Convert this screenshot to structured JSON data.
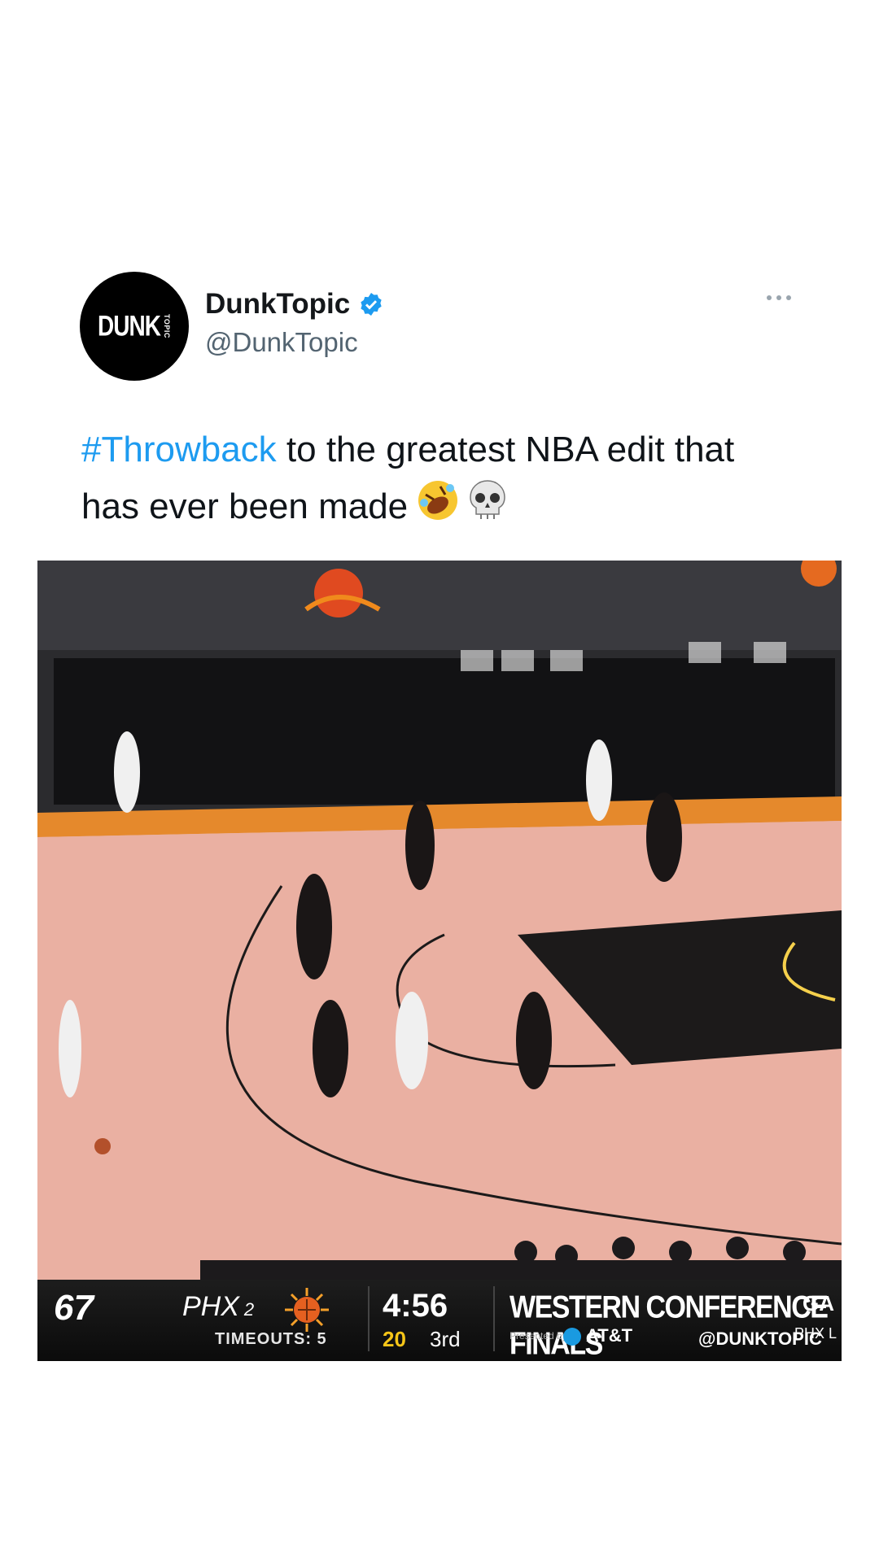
{
  "tweet": {
    "display_name": "DunkTopic",
    "handle": "@DunkTopic",
    "avatar_text": "DUNK",
    "avatar_subtext": "TOPIC",
    "hashtag": "#Throwback",
    "text": " to the greatest NBA edit that has ever been made",
    "emojis": [
      "rolling-on-floor-laughing-emoji",
      "skull-emoji"
    ],
    "accent_color": "#1d9bf0"
  },
  "video": {
    "scoreboard": {
      "home_score": "67",
      "team": "PHX",
      "team_seed": "2",
      "timeouts": "TIMEOUTS: 5",
      "game_clock": "4:56",
      "shot_clock": "20",
      "period": "3rd",
      "series": "WESTERN CONFERENCE FINALS",
      "presented_by": "Presented by",
      "sponsor": "AT&T",
      "game_label": "GA",
      "series_status": "PHX L"
    },
    "watermark": "@DUNKTOPIC"
  }
}
